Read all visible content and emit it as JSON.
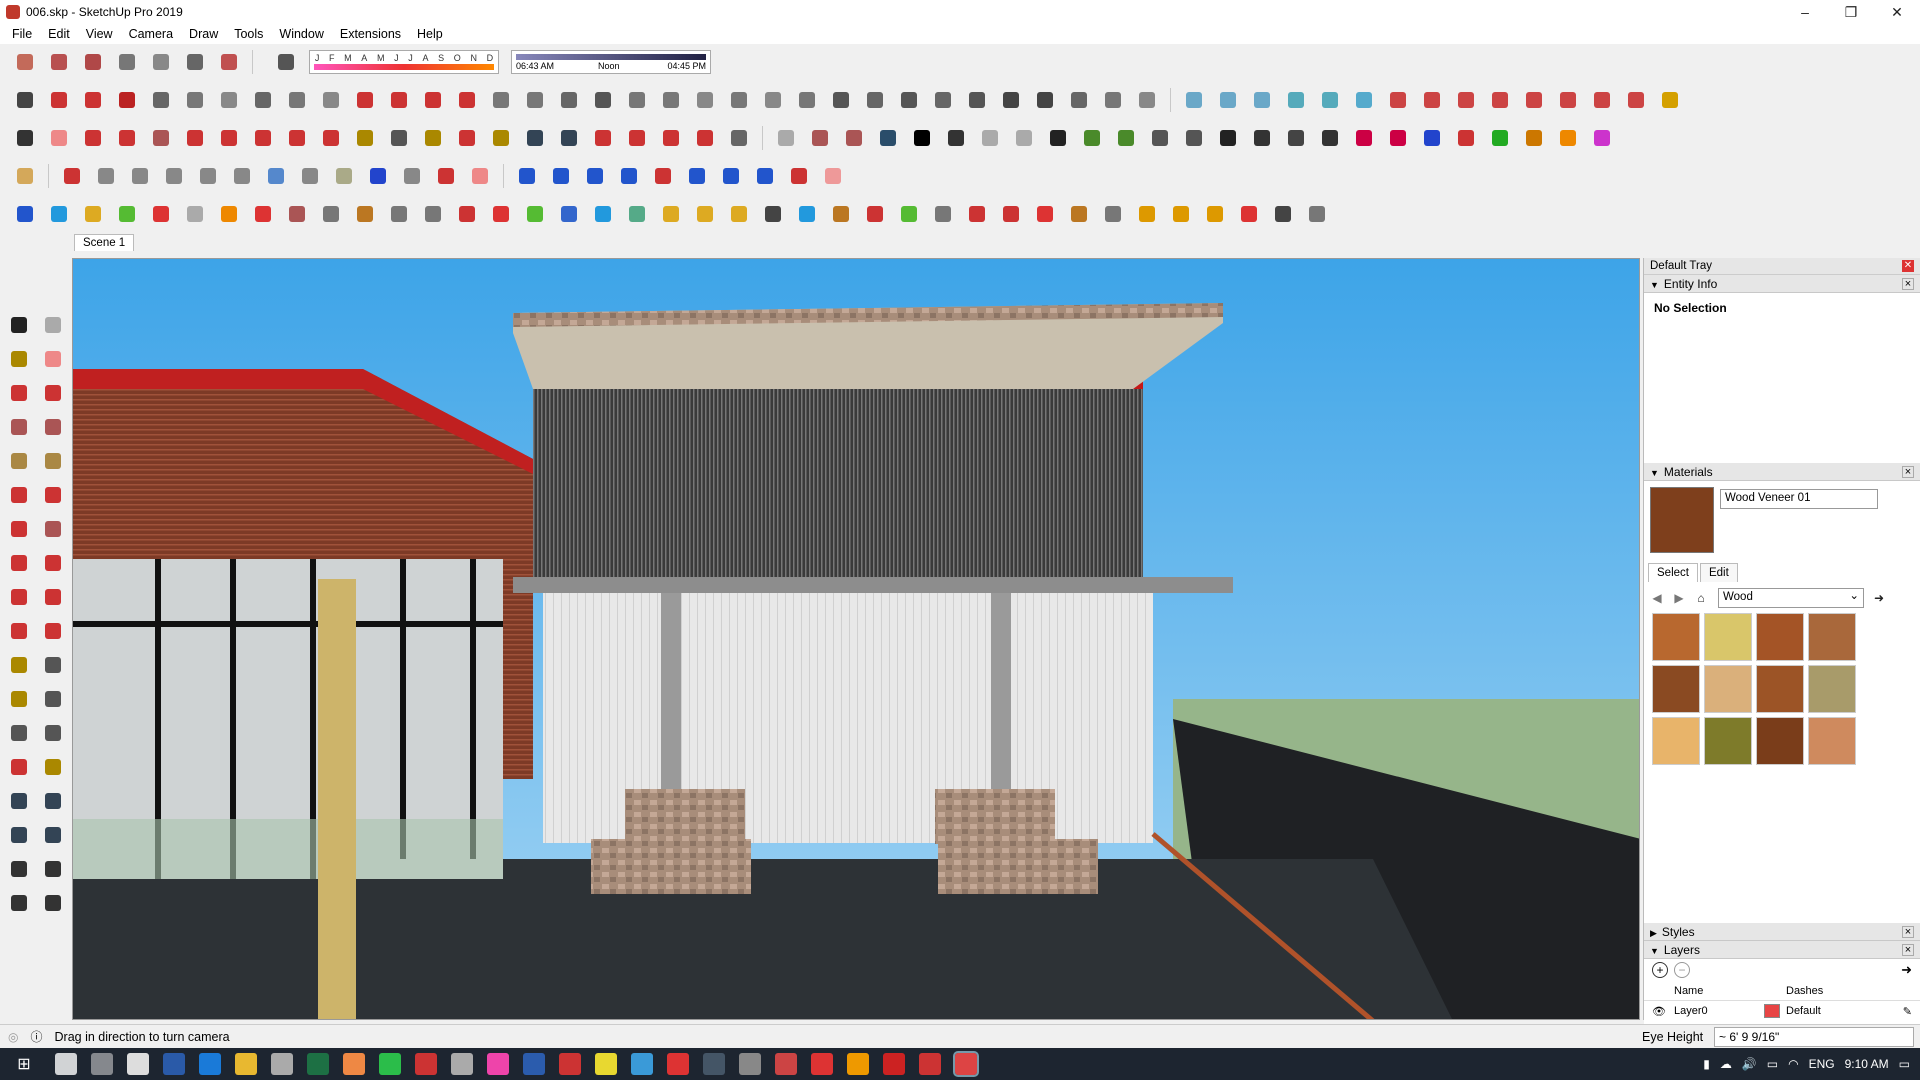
{
  "window": {
    "title": "006.skp - SketchUp Pro 2019",
    "minimize": "–",
    "maximize": "❐",
    "close": "✕"
  },
  "menu": [
    "File",
    "Edit",
    "View",
    "Camera",
    "Draw",
    "Tools",
    "Window",
    "Extensions",
    "Help"
  ],
  "shadow": {
    "months": [
      "J",
      "F",
      "M",
      "A",
      "M",
      "J",
      "J",
      "A",
      "S",
      "O",
      "N",
      "D"
    ],
    "time_start": "06:43 AM",
    "time_mid": "Noon",
    "time_end": "04:45 PM"
  },
  "scene_tab": "Scene 1",
  "tray": {
    "title": "Default Tray",
    "entity_info": {
      "title": "Entity Info",
      "value": "No Selection"
    },
    "materials": {
      "title": "Materials",
      "name": "Wood Veneer 01",
      "tab_select": "Select",
      "tab_edit": "Edit",
      "library": "Wood",
      "swatches": [
        "#b8682f",
        "#d9c66a",
        "#a45426",
        "#a9683b",
        "#8a4a22",
        "#dab07b",
        "#9c5426",
        "#a89b6a",
        "#e8b46a",
        "#7e7b2a",
        "#7a3d1a",
        "#cf8a5e"
      ]
    },
    "styles": {
      "title": "Styles"
    },
    "layers": {
      "title": "Layers",
      "col_name": "Name",
      "col_dashes": "Dashes",
      "layer_name": "Layer0",
      "layer_dashes": "Default",
      "layer_color": "#e84545"
    }
  },
  "status": {
    "hint": "Drag in direction to turn camera",
    "eye_label": "Eye Height",
    "eye_value": "~ 6' 9 9/16\""
  },
  "taskbar": {
    "lang": "ENG",
    "time": "9:10 AM"
  }
}
